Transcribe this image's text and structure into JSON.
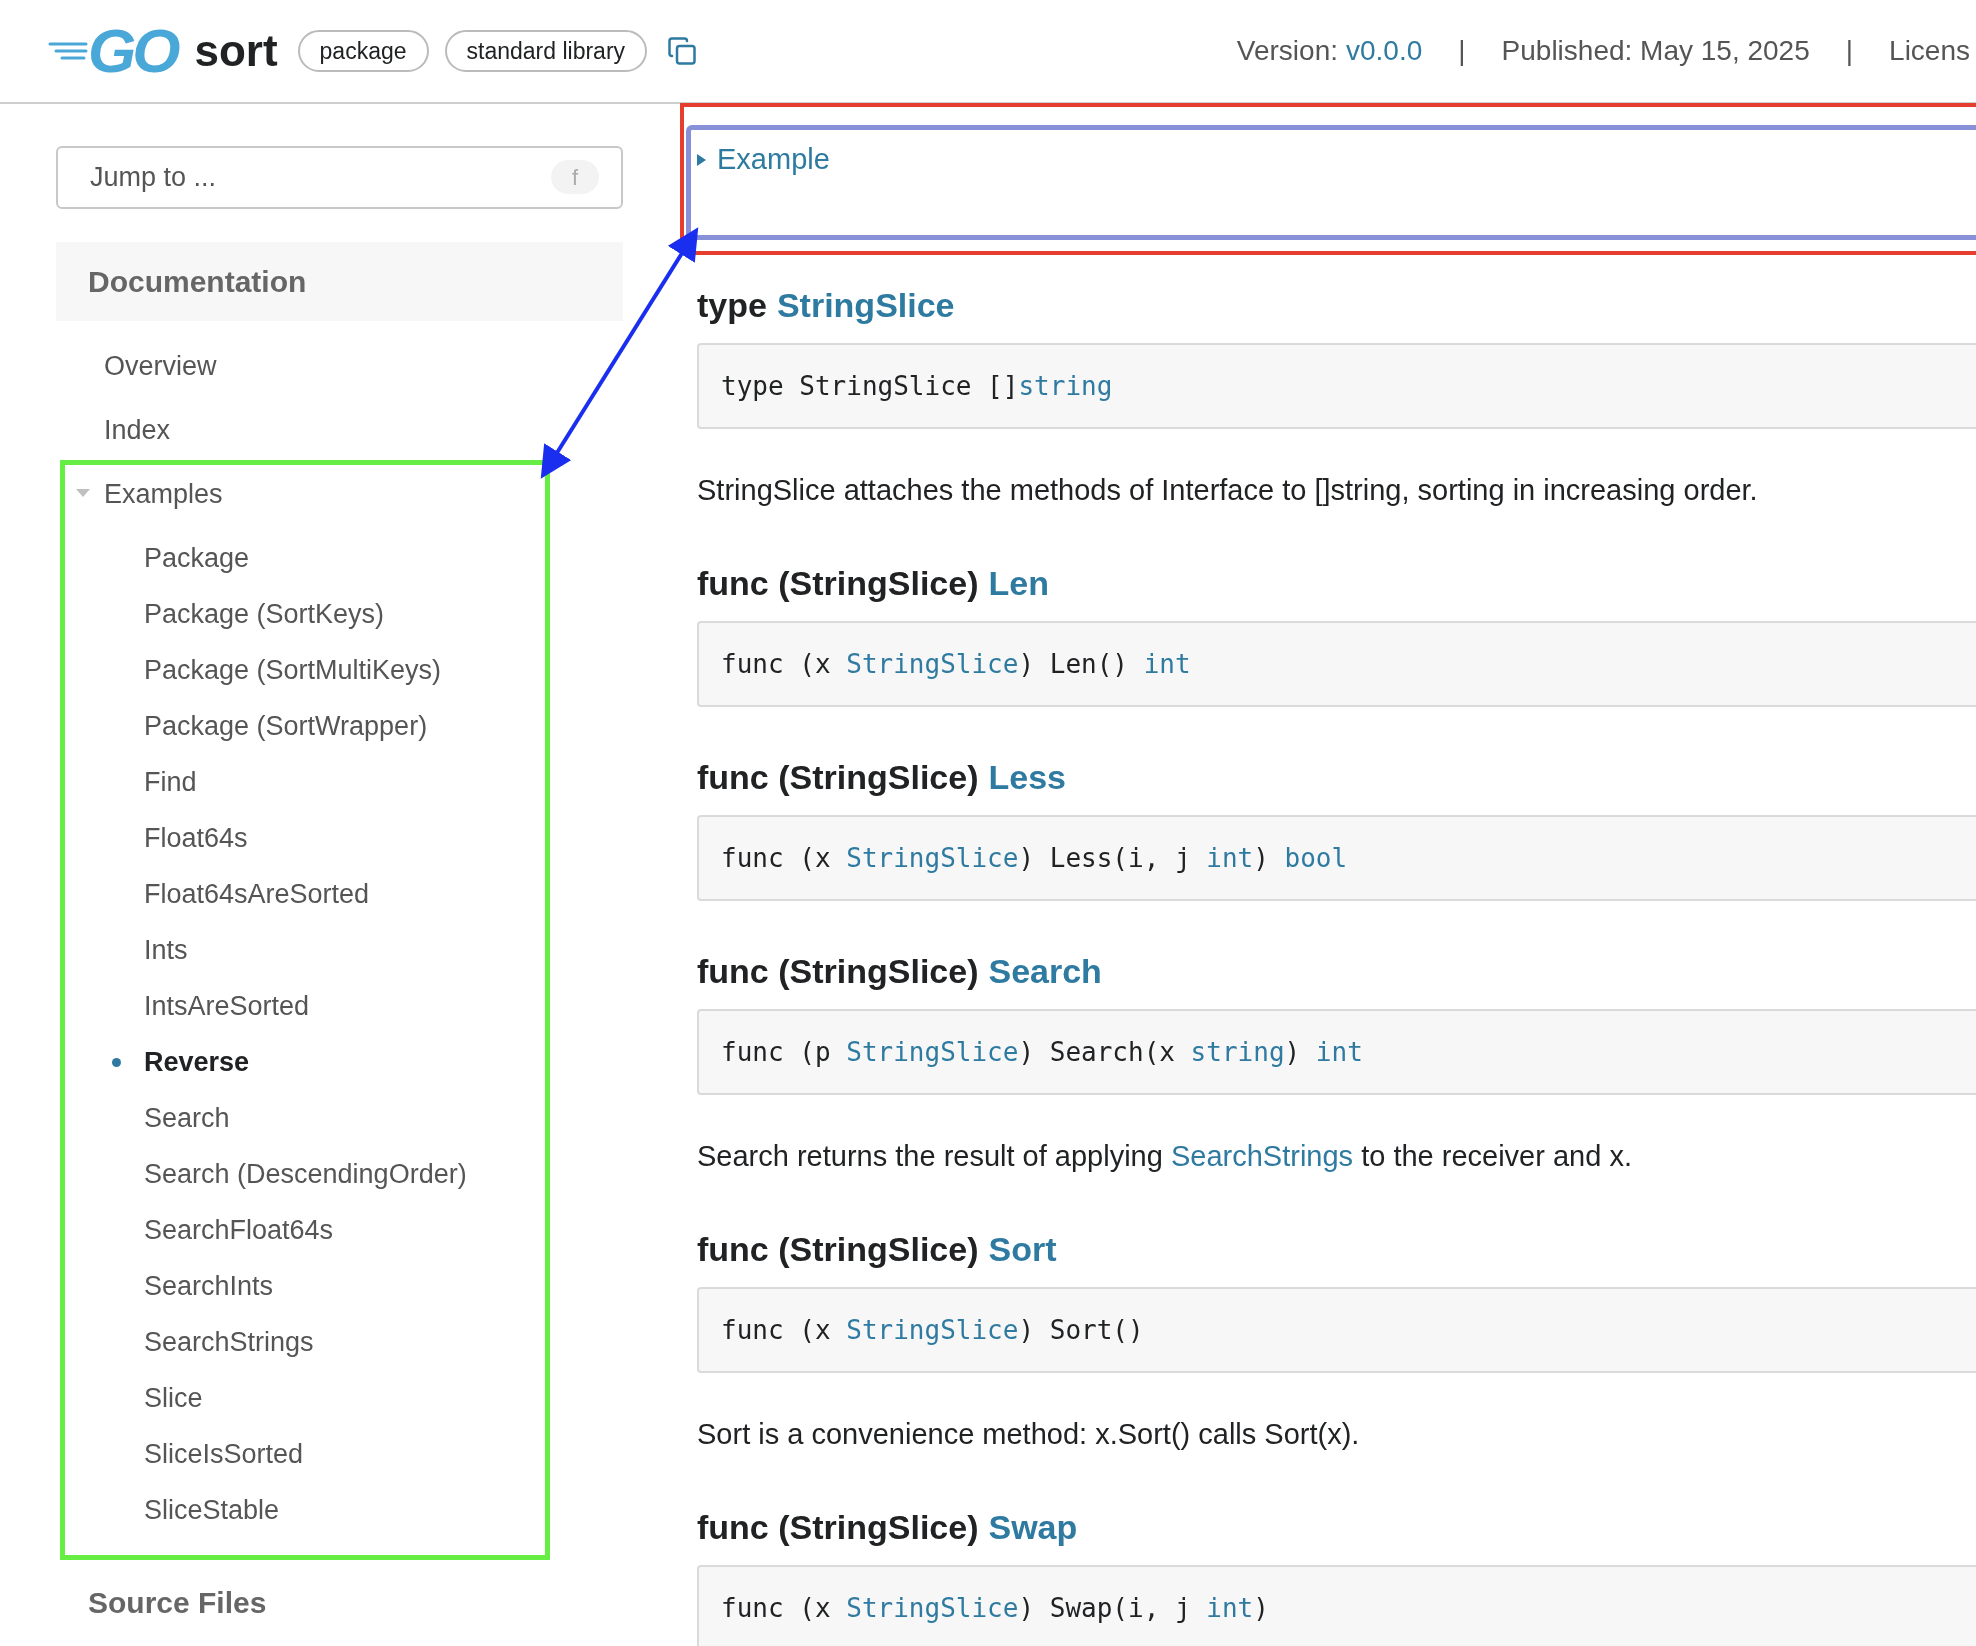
{
  "header": {
    "logo_text": "GO",
    "package_name": "sort",
    "badges": [
      "package",
      "standard library"
    ],
    "version_label": "Version:",
    "version": "v0.0.0",
    "separator_1": "|",
    "published": "Published: May 15, 2025",
    "separator_2": "|",
    "license_cut": "Licens"
  },
  "sidebar": {
    "jump_placeholder": "Jump to ...",
    "jump_key": "f",
    "section_title": "Documentation",
    "items": [
      {
        "label": "Overview",
        "kind": "link"
      },
      {
        "label": "Index",
        "kind": "link"
      },
      {
        "label": "Examples",
        "kind": "group",
        "expanded": true,
        "children": [
          {
            "label": "Package",
            "selected": false
          },
          {
            "label": "Package (SortKeys)",
            "selected": false
          },
          {
            "label": "Package (SortMultiKeys)",
            "selected": false
          },
          {
            "label": "Package (SortWrapper)",
            "selected": false
          },
          {
            "label": "Find",
            "selected": false
          },
          {
            "label": "Float64s",
            "selected": false
          },
          {
            "label": "Float64sAreSorted",
            "selected": false
          },
          {
            "label": "Ints",
            "selected": false
          },
          {
            "label": "IntsAreSorted",
            "selected": false
          },
          {
            "label": "Reverse",
            "selected": true
          },
          {
            "label": "Search",
            "selected": false
          },
          {
            "label": "Search (DescendingOrder)",
            "selected": false
          },
          {
            "label": "SearchFloat64s",
            "selected": false
          },
          {
            "label": "SearchInts",
            "selected": false
          },
          {
            "label": "SearchStrings",
            "selected": false
          },
          {
            "label": "Slice",
            "selected": false
          },
          {
            "label": "SliceIsSorted",
            "selected": false
          },
          {
            "label": "SliceStable",
            "selected": false
          }
        ]
      }
    ],
    "footer_title": "Source Files"
  },
  "example": {
    "label": "Example",
    "expanded": false
  },
  "sections": [
    {
      "keyword": "type",
      "name": "StringSlice",
      "code": [
        {
          "text": "type StringSlice []",
          "kind": "plain"
        },
        {
          "text": "string",
          "kind": "link"
        }
      ],
      "description": [
        {
          "text": "StringSlice attaches the methods of Interface to []string, sorting in increasing order.",
          "kind": "plain"
        }
      ]
    },
    {
      "keyword": "func (StringSlice)",
      "name": "Len",
      "code": [
        {
          "text": "func (x ",
          "kind": "plain"
        },
        {
          "text": "StringSlice",
          "kind": "link"
        },
        {
          "text": ") Len() ",
          "kind": "plain"
        },
        {
          "text": "int",
          "kind": "link"
        }
      ]
    },
    {
      "keyword": "func (StringSlice)",
      "name": "Less",
      "code": [
        {
          "text": "func (x ",
          "kind": "plain"
        },
        {
          "text": "StringSlice",
          "kind": "link"
        },
        {
          "text": ") Less(i, j ",
          "kind": "plain"
        },
        {
          "text": "int",
          "kind": "link"
        },
        {
          "text": ") ",
          "kind": "plain"
        },
        {
          "text": "bool",
          "kind": "link"
        }
      ]
    },
    {
      "keyword": "func (StringSlice)",
      "name": "Search",
      "code": [
        {
          "text": "func (p ",
          "kind": "plain"
        },
        {
          "text": "StringSlice",
          "kind": "link"
        },
        {
          "text": ") Search(x ",
          "kind": "plain"
        },
        {
          "text": "string",
          "kind": "link"
        },
        {
          "text": ") ",
          "kind": "plain"
        },
        {
          "text": "int",
          "kind": "link"
        }
      ],
      "description": [
        {
          "text": "Search returns the result of applying ",
          "kind": "plain"
        },
        {
          "text": "SearchStrings",
          "kind": "link"
        },
        {
          "text": " to the receiver and x.",
          "kind": "plain"
        }
      ]
    },
    {
      "keyword": "func (StringSlice)",
      "name": "Sort",
      "code": [
        {
          "text": "func (x ",
          "kind": "plain"
        },
        {
          "text": "StringSlice",
          "kind": "link"
        },
        {
          "text": ") Sort()",
          "kind": "plain"
        }
      ],
      "description": [
        {
          "text": "Sort is a convenience method: x.Sort() calls Sort(x).",
          "kind": "plain"
        }
      ]
    },
    {
      "keyword": "func (StringSlice)",
      "name": "Swap",
      "code": [
        {
          "text": "func (x ",
          "kind": "plain"
        },
        {
          "text": "StringSlice",
          "kind": "link"
        },
        {
          "text": ") Swap(i, j ",
          "kind": "plain"
        },
        {
          "text": "int",
          "kind": "link"
        },
        {
          "text": ")",
          "kind": "plain"
        }
      ]
    }
  ]
}
